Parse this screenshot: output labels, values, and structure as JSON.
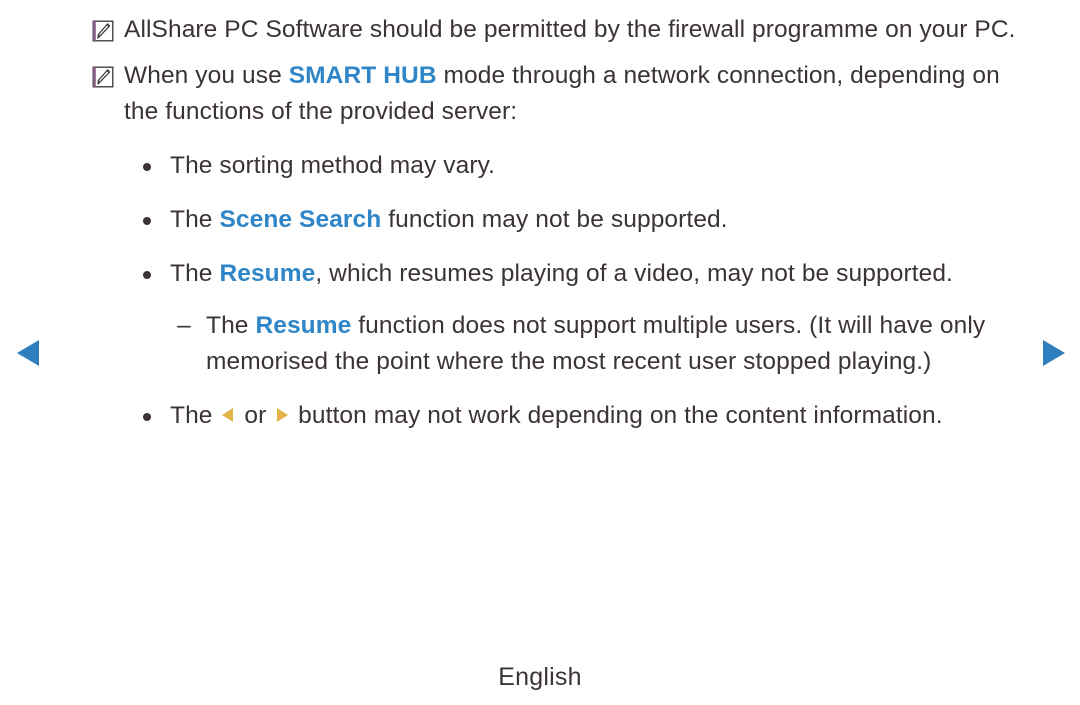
{
  "page": {
    "footer_label": "English",
    "background_color": "#ffffff",
    "text_color": "#3b3337",
    "highlight_color": "#2e86c8",
    "nav_arrow_color": "#2f7fbf",
    "inline_arrow_color": "#e3b44a"
  },
  "navigation": {
    "prev_icon": "triangle-left-icon",
    "prev_label": "Previous page",
    "next_icon": "triangle-right-icon",
    "next_label": "Next page"
  },
  "notes": [
    {
      "icon": "note-pencil-icon",
      "text": "AllShare PC Software should be permitted by the firewall programme on your PC."
    },
    {
      "icon": "note-pencil-icon",
      "lead": "When you use ",
      "highlight": "SMART HUB",
      "tail": " mode through a network connection, depending on the functions of the provided server:"
    }
  ],
  "bullets": [
    {
      "marker": "bullet-dot",
      "lead": "The sorting method may vary.",
      "highlight": "",
      "tail": ""
    },
    {
      "marker": "bullet-dot",
      "lead": "The ",
      "highlight": "Scene Search",
      "tail": " function may not be supported."
    },
    {
      "marker": "bullet-dot",
      "lead": "The ",
      "highlight": "Resume",
      "tail": ", which resumes playing of a video, may not be supported."
    }
  ],
  "sub_item": {
    "marker": "–",
    "lead": "The ",
    "highlight": "Resume",
    "tail": " function does not support multiple users. (It will have only memorised the point where the most recent user stopped playing.)"
  },
  "last_bullet": {
    "marker": "bullet-dot",
    "lead": "The ",
    "left_arrow_icon": "arrow-left-inline-icon",
    "middle": " or ",
    "right_arrow_icon": "arrow-right-inline-icon",
    "tail": " button may not work depending on the content information."
  }
}
